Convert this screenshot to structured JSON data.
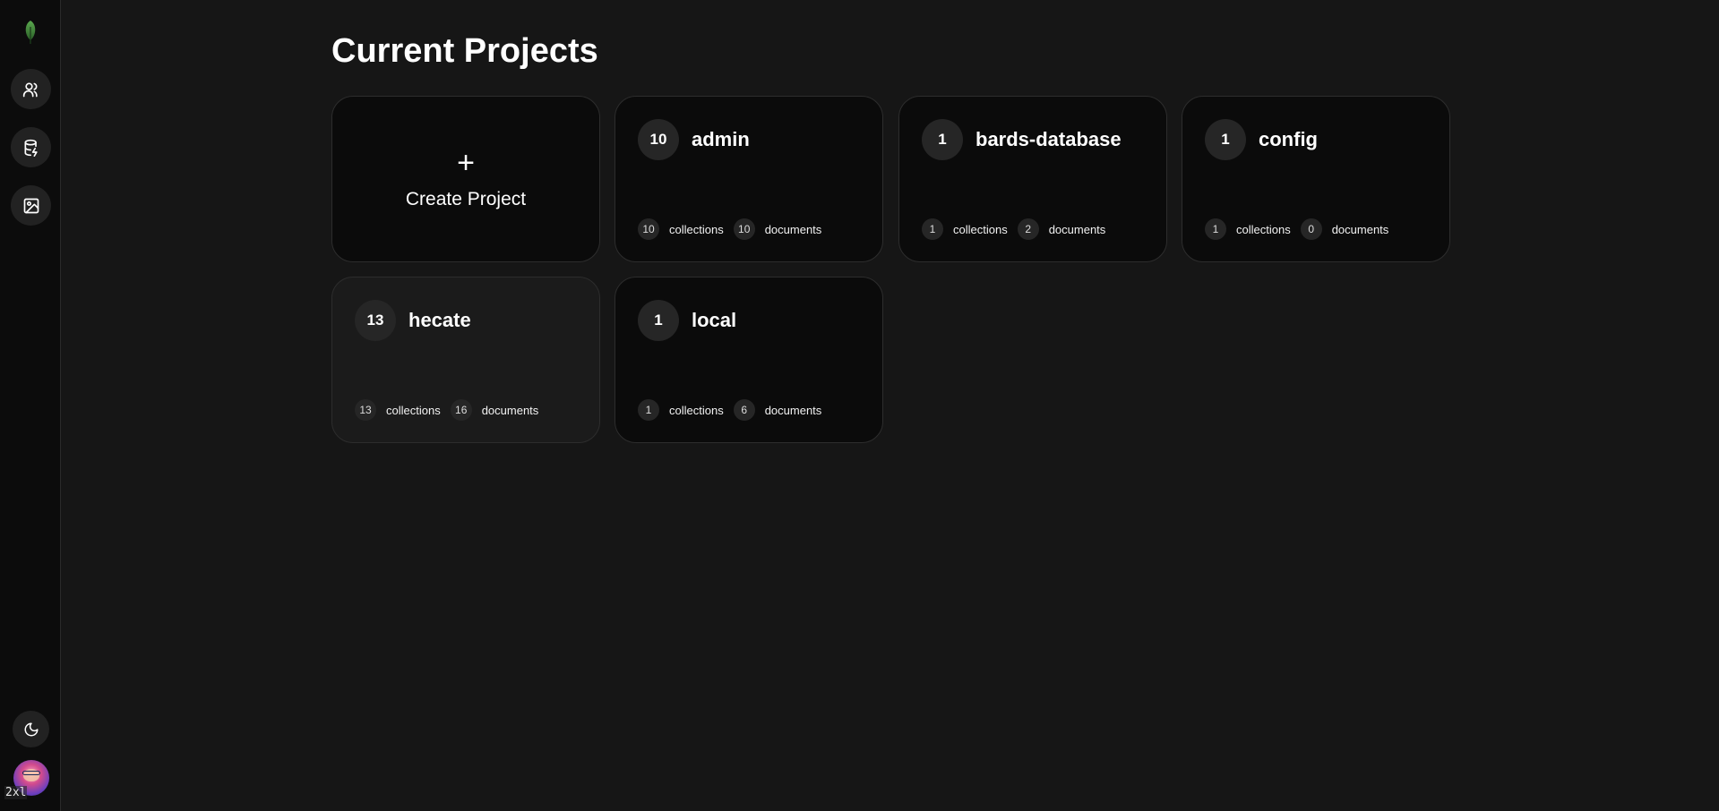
{
  "sidebar": {
    "logo": "leaf-logo",
    "nav": [
      {
        "name": "users-icon"
      },
      {
        "name": "database-icon"
      },
      {
        "name": "image-icon"
      }
    ],
    "theme_icon": "moon-icon",
    "breakpoint_label": "2xl"
  },
  "page": {
    "title": "Current Projects"
  },
  "create": {
    "plus": "+",
    "label": "Create Project"
  },
  "projects": [
    {
      "name": "admin",
      "count": "10",
      "collections": "10",
      "collections_label": "collections",
      "documents": "10",
      "documents_label": "documents"
    },
    {
      "name": "bards-database",
      "count": "1",
      "collections": "1",
      "collections_label": "collections",
      "documents": "2",
      "documents_label": "documents"
    },
    {
      "name": "config",
      "count": "1",
      "collections": "1",
      "collections_label": "collections",
      "documents": "0",
      "documents_label": "documents"
    },
    {
      "name": "hecate",
      "count": "13",
      "collections": "13",
      "collections_label": "collections",
      "documents": "16",
      "documents_label": "documents"
    },
    {
      "name": "local",
      "count": "1",
      "collections": "1",
      "collections_label": "collections",
      "documents": "6",
      "documents_label": "documents"
    }
  ],
  "colors": {
    "background": "#161616",
    "sidebar": "#0c0c0c",
    "card": "#0b0b0b",
    "card_hover": "#1b1b1b",
    "badge": "#262626",
    "logo_green": "#3f8a3a"
  }
}
